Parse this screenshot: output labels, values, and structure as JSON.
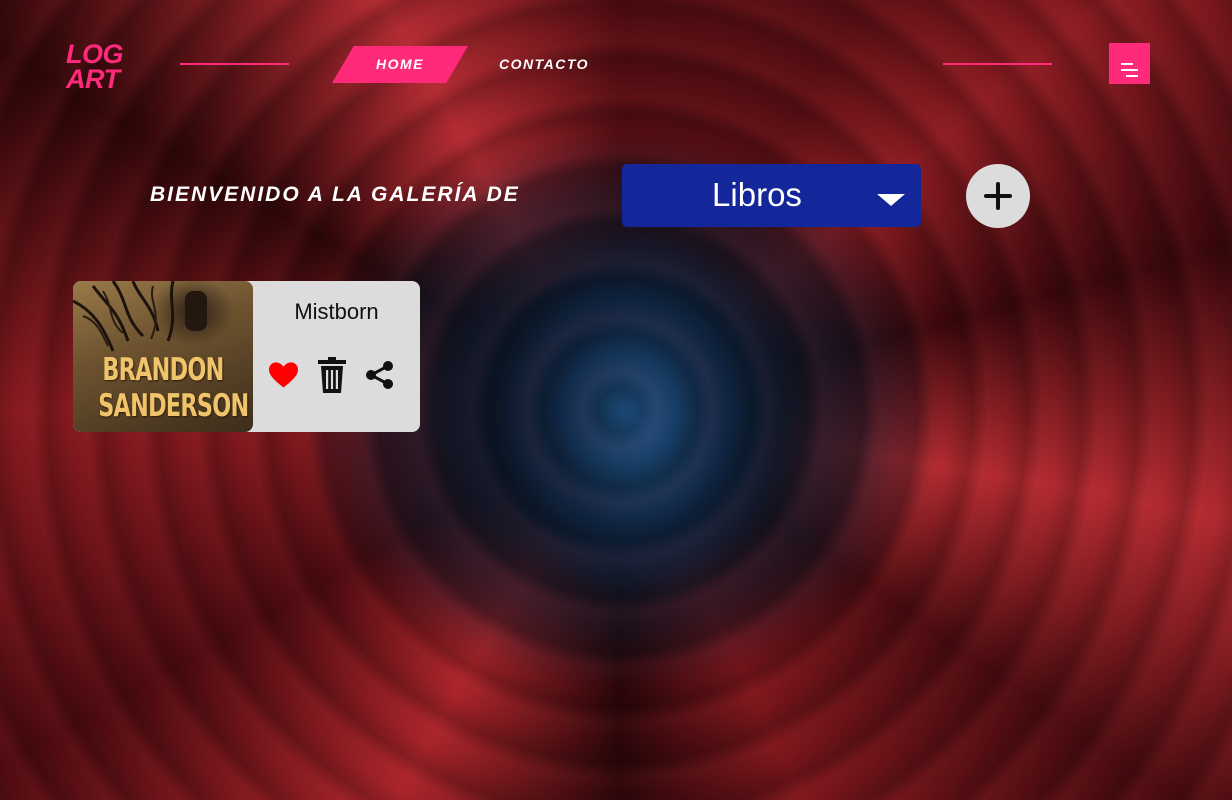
{
  "brand": {
    "logo_line1": "LOG",
    "logo_line2": "ART",
    "accent_color": "#ff2a7a"
  },
  "nav": {
    "items": [
      {
        "label": "HOME",
        "active": true
      },
      {
        "label": "CONTACTO",
        "active": false
      }
    ],
    "menu_icon": "menu-icon"
  },
  "gallery": {
    "welcome_text": "BIENVENIDO A LA GALERÍA DE",
    "category_select": {
      "selected": "Libros",
      "background_color": "#13279a"
    },
    "add_icon": "plus-icon"
  },
  "cards": [
    {
      "title": "Mistborn",
      "cover_text_line1": "BRANDON",
      "cover_text_line2": "SANDERSON",
      "liked": true,
      "like_icon": "heart-icon",
      "delete_icon": "trash-icon",
      "share_icon": "share-icon",
      "heart_color": "#ff0000"
    }
  ]
}
